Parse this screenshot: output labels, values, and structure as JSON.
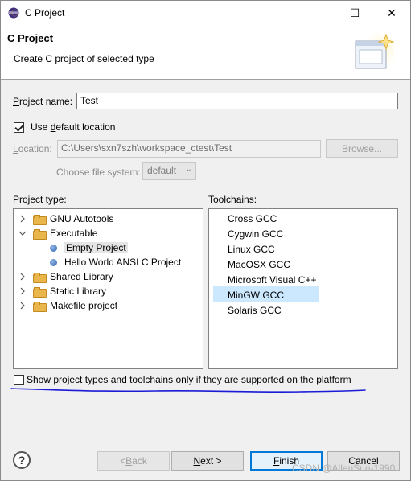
{
  "window": {
    "title": "C Project",
    "minimize_glyph": "—",
    "maximize_glyph": "☐",
    "close_glyph": "✕"
  },
  "banner": {
    "title": "C Project",
    "description": "Create C project of selected type"
  },
  "project_name": {
    "label_pre": "",
    "label_ul": "P",
    "label_post": "roject name:",
    "value": "Test"
  },
  "default_location": {
    "checked": true,
    "label_pre": "Use ",
    "label_ul": "d",
    "label_post": "efault location"
  },
  "location": {
    "label_pre": "",
    "label_ul": "L",
    "label_post": "ocation:",
    "value": "C:\\Users\\sxn7szh\\workspace_ctest\\Test",
    "browse_label": "Browse..."
  },
  "file_system": {
    "label": "Choose file system:",
    "value": "default"
  },
  "project_type": {
    "label": "Project type:",
    "items": [
      {
        "label": "GNU Autotools",
        "kind": "folder",
        "expanded": false
      },
      {
        "label": "Executable",
        "kind": "folder",
        "expanded": true
      },
      {
        "label": "Empty Project",
        "kind": "leaf",
        "selected": true
      },
      {
        "label": "Hello World ANSI C Project",
        "kind": "leaf"
      },
      {
        "label": "Shared Library",
        "kind": "folder",
        "expanded": false
      },
      {
        "label": "Static Library",
        "kind": "folder",
        "expanded": false
      },
      {
        "label": "Makefile project",
        "kind": "folder",
        "expanded": false
      }
    ]
  },
  "toolchains": {
    "label": "Toolchains:",
    "items": [
      "Cross GCC",
      "Cygwin GCC",
      "Linux GCC",
      "MacOSX GCC",
      "Microsoft Visual C++",
      "MinGW GCC",
      "Solaris GCC"
    ],
    "selected": "MinGW GCC"
  },
  "supported_only": {
    "checked": false,
    "label": "Show project types and toolchains only if they are supported on the platform"
  },
  "buttons": {
    "back_pre": "< ",
    "back_ul": "B",
    "back_post": "ack",
    "next_ul": "N",
    "next_post": "ext >",
    "finish_ul": "F",
    "finish_post": "inish",
    "cancel": "Cancel"
  },
  "help_glyph": "?",
  "watermark": "CSDN @AllenSun-1990",
  "colors": {
    "selection": "#cce8ff",
    "default_button_border": "#0078d7",
    "annotation_ink": "#1b1bd6"
  }
}
